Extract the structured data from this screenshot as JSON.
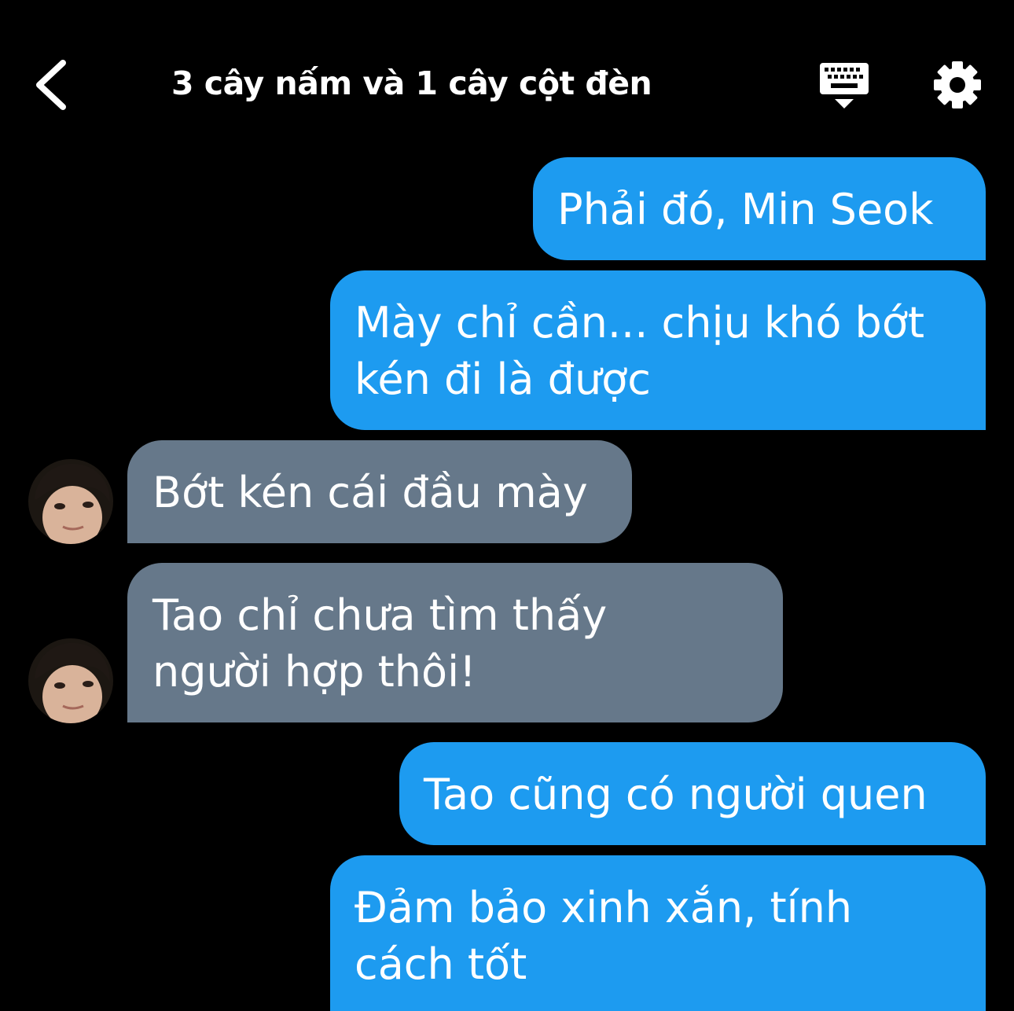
{
  "header": {
    "title": "3 cây nấm và 1 cây cột đèn",
    "back_icon": "chevron-left-icon",
    "keyboard_icon": "keyboard-icon",
    "settings_icon": "gear-icon"
  },
  "colors": {
    "background": "#000000",
    "outgoing_bubble": "#1d9bf0",
    "incoming_bubble": "#66788a",
    "text": "#ffffff"
  },
  "messages": [
    {
      "direction": "outgoing",
      "lines": [
        "Phải đó, Min Seok"
      ]
    },
    {
      "direction": "outgoing",
      "lines": [
        "Mày chỉ cần... chịu khó bớt",
        "kén đi là được"
      ]
    },
    {
      "direction": "incoming",
      "lines": [
        "Bớt kén cái đầu mày"
      ]
    },
    {
      "direction": "incoming",
      "lines": [
        "Tao chỉ chưa tìm thấy",
        "người hợp thôi!"
      ]
    },
    {
      "direction": "outgoing",
      "lines": [
        "Tao cũng có người quen"
      ]
    },
    {
      "direction": "outgoing",
      "lines": [
        "Đảm bảo xinh xắn, tính",
        "cách tốt"
      ]
    }
  ]
}
